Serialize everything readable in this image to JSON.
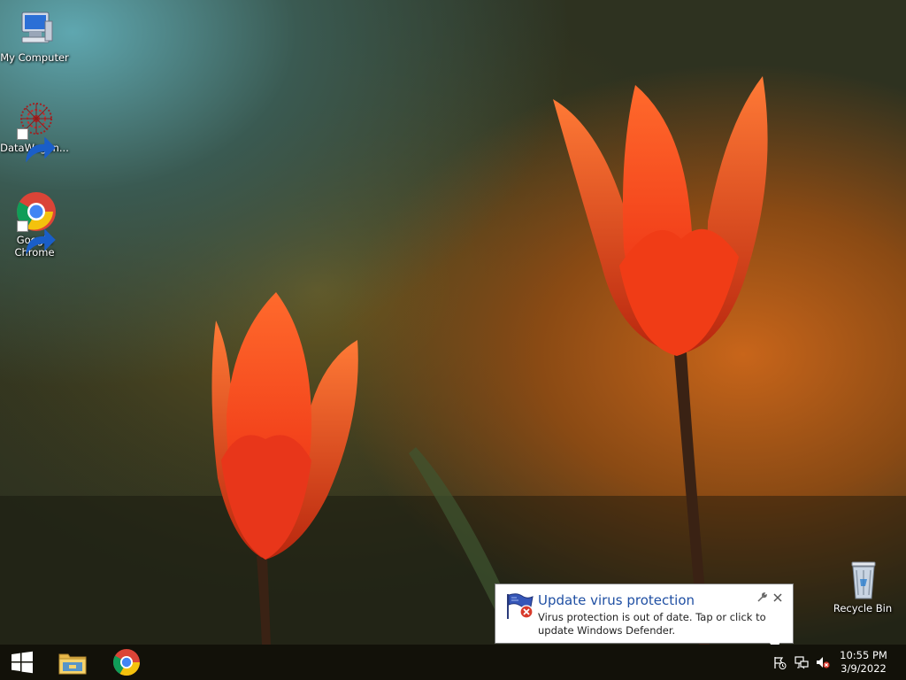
{
  "desktop": {
    "icons": [
      {
        "label": "My Computer",
        "icon": "computer-icon"
      },
      {
        "label": "DataWagon...",
        "icon": "datawagon-icon"
      },
      {
        "label": "Google Chrome",
        "icon": "chrome-icon"
      },
      {
        "label": "Recycle Bin",
        "icon": "recycle-bin-icon"
      }
    ]
  },
  "notification": {
    "title": "Update virus protection",
    "message": "Virus protection is out of date. Tap or click to update Windows Defender.",
    "icon": "defender-flag-error-icon",
    "settings_icon": "wrench-icon",
    "close_icon": "close-icon"
  },
  "taskbar": {
    "start_icon": "windows-start-icon",
    "pinned": [
      {
        "icon": "file-explorer-icon"
      },
      {
        "icon": "chrome-icon"
      }
    ],
    "tray": {
      "icons": [
        "action-center-flag-icon",
        "network-icon",
        "volume-muted-icon"
      ],
      "time": "10:55 PM",
      "date": "3/9/2022"
    }
  },
  "colors": {
    "taskbar": "#121109",
    "notification_title": "#1f4fa3",
    "tulip": "#ff4a14"
  }
}
